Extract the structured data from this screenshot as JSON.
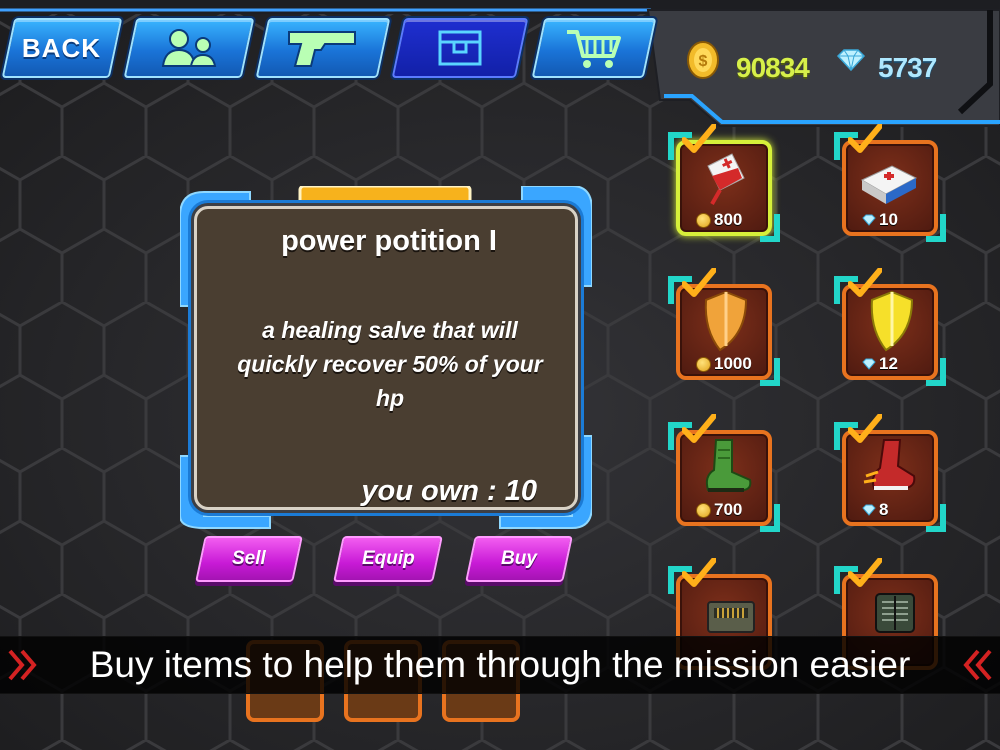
{
  "nav": {
    "back_label": "BACK",
    "tabs": [
      {
        "icon": "team-icon",
        "active": false
      },
      {
        "icon": "pistol-icon",
        "active": false
      },
      {
        "icon": "inventory-box-icon",
        "active": true
      },
      {
        "icon": "shopping-cart-icon",
        "active": false
      }
    ]
  },
  "currency": {
    "coins": "90834",
    "gems": "5737"
  },
  "item_detail": {
    "title": "power potition I",
    "description": "a healing salve that will quickly recover 50% of your hp",
    "owned_label": "you own : 10"
  },
  "actions": {
    "sell": "Sell",
    "equip": "Equip",
    "buy": "Buy"
  },
  "items": [
    {
      "name": "blood-potion",
      "currency": "coin",
      "price": "800",
      "selected": true,
      "icon": "blood-bag-icon"
    },
    {
      "name": "medkit",
      "currency": "gem",
      "price": "10",
      "selected": false,
      "icon": "medkit-icon"
    },
    {
      "name": "bronze-shield",
      "currency": "coin",
      "price": "1000",
      "selected": false,
      "icon": "shield-icon"
    },
    {
      "name": "gold-shield",
      "currency": "gem",
      "price": "12",
      "selected": false,
      "icon": "shield-icon"
    },
    {
      "name": "green-boots",
      "currency": "coin",
      "price": "700",
      "selected": false,
      "icon": "boot-icon"
    },
    {
      "name": "red-boots",
      "currency": "gem",
      "price": "8",
      "selected": false,
      "icon": "boot-icon"
    },
    {
      "name": "ammo-crate",
      "icon": "ammo-icon"
    },
    {
      "name": "armor-vest",
      "icon": "vest-icon"
    }
  ],
  "caption": "Buy items to help them through the mission easier",
  "colors": {
    "accent_blue": "#1a74d8",
    "frame_orange": "#e8731f",
    "button_magenta": "#c81ad6",
    "coin_text": "#d7f04a"
  }
}
